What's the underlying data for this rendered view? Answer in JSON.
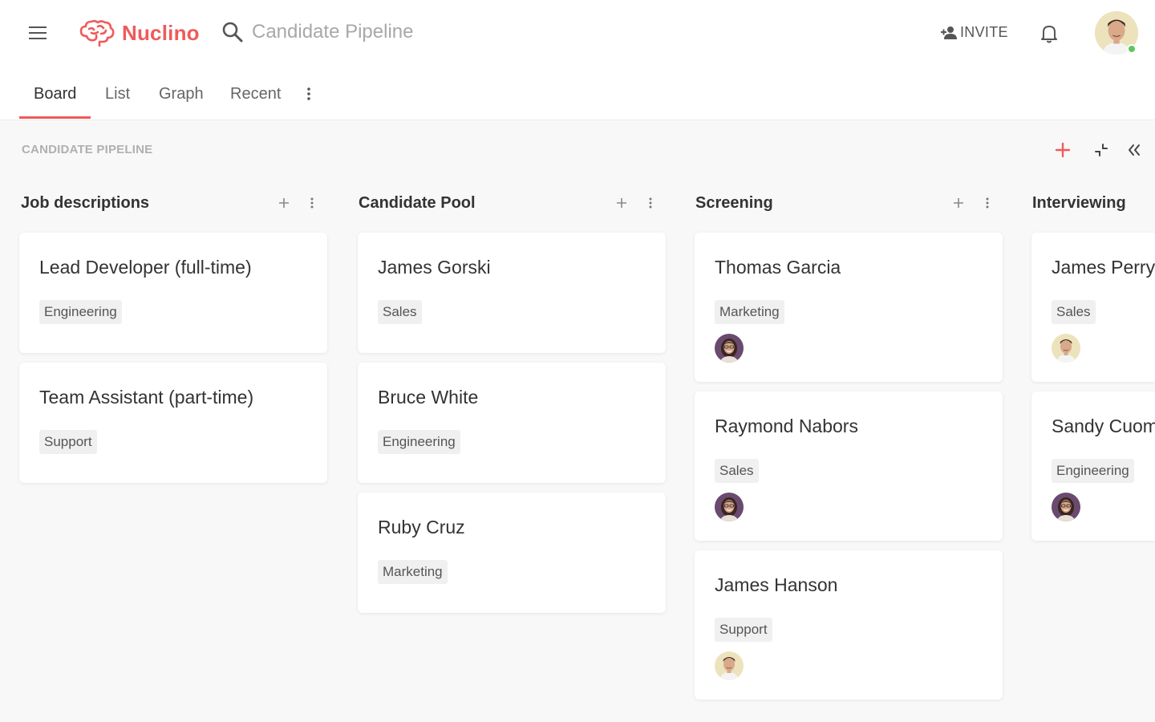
{
  "app": {
    "name": "Nuclino"
  },
  "search": {
    "text": "Candidate Pipeline"
  },
  "header": {
    "invite_label": "INVITE"
  },
  "tabs": [
    {
      "label": "Board"
    },
    {
      "label": "List"
    },
    {
      "label": "Graph"
    },
    {
      "label": "Recent"
    }
  ],
  "cluster": {
    "title": "CANDIDATE PIPELINE"
  },
  "colors": {
    "accent": "#f05a5a",
    "online": "#5cc85c"
  },
  "columns": [
    {
      "title": "Job descriptions",
      "cards": [
        {
          "title": "Lead Developer (full-time)",
          "tag": "Engineering"
        },
        {
          "title": "Team Assistant (part-time)",
          "tag": "Support"
        }
      ]
    },
    {
      "title": "Candidate Pool",
      "cards": [
        {
          "title": "James Gorski",
          "tag": "Sales"
        },
        {
          "title": "Bruce White",
          "tag": "Engineering"
        },
        {
          "title": "Ruby Cruz",
          "tag": "Marketing"
        }
      ]
    },
    {
      "title": "Screening",
      "cards": [
        {
          "title": "Thomas Garcia",
          "tag": "Marketing",
          "assignee": "woman-avatar"
        },
        {
          "title": "Raymond Nabors",
          "tag": "Sales",
          "assignee": "woman-avatar"
        },
        {
          "title": "James Hanson",
          "tag": "Support",
          "assignee": "man-avatar"
        }
      ]
    },
    {
      "title": "Interviewing",
      "cards": [
        {
          "title": "James Perry",
          "tag": "Sales",
          "assignee": "man-avatar"
        },
        {
          "title": "Sandy Cuomo",
          "tag": "Engineering",
          "assignee": "woman-avatar"
        }
      ]
    }
  ]
}
